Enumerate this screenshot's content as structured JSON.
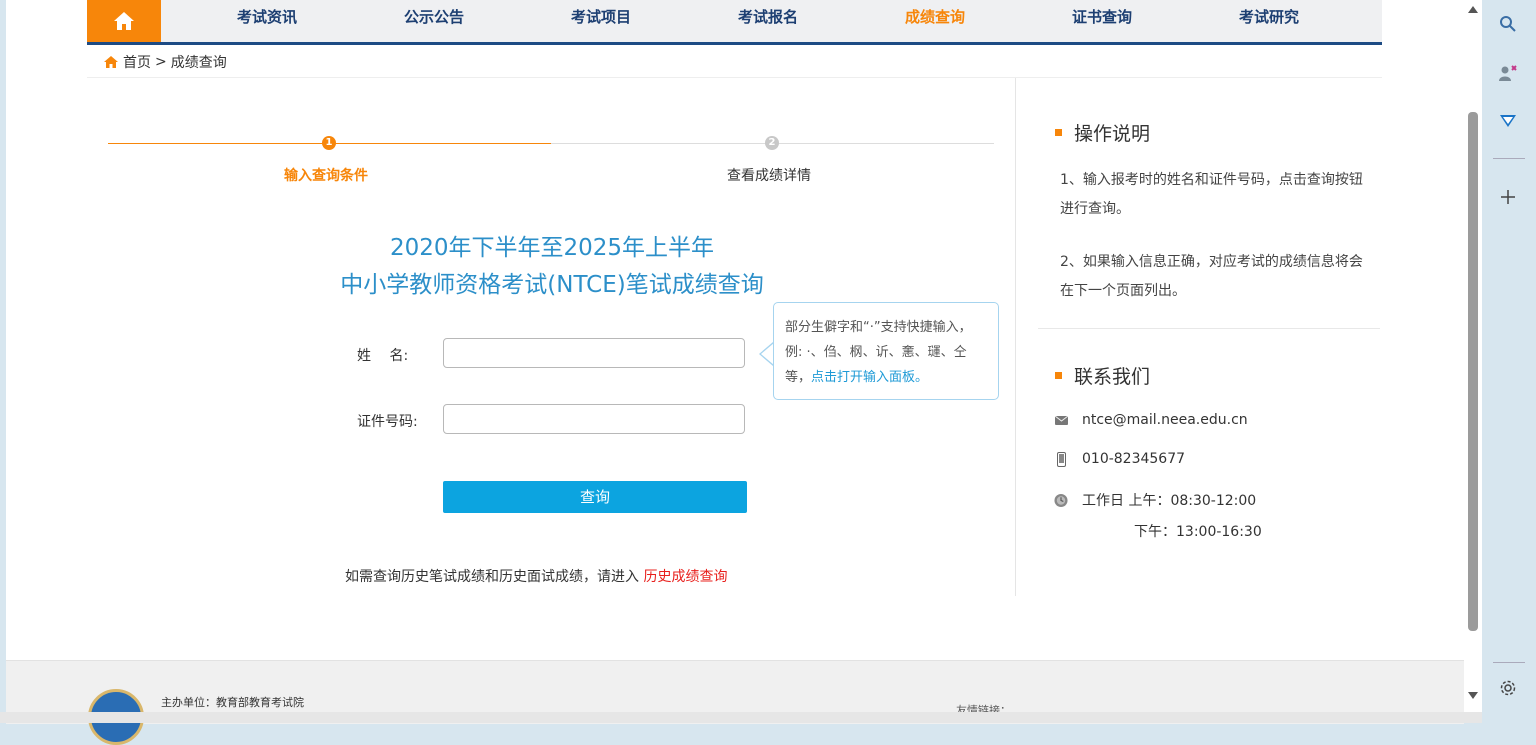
{
  "nav": {
    "items": [
      "考试资讯",
      "公示公告",
      "考试项目",
      "考试报名",
      "成绩查询",
      "证书查询",
      "考试研究"
    ],
    "active": "成绩查询"
  },
  "breadcrumb": {
    "home": "首页",
    "sep": ">",
    "current": "成绩查询"
  },
  "steps": [
    {
      "num": "1",
      "label": "输入查询条件",
      "active": true
    },
    {
      "num": "2",
      "label": "查看成绩详情",
      "active": false
    }
  ],
  "title": {
    "line1": "2020年下半年至2025年上半年",
    "line2": "中小学教师资格考试(NTCE)笔试成绩查询"
  },
  "form": {
    "name_label": "姓　 名:",
    "id_label": "证件号码:",
    "name_value": "",
    "id_value": "",
    "submit_label": "查询"
  },
  "tip": {
    "text": "部分生僻字和“·”支持快捷输入，例: ·、㑇、㭎、䜣、㥣、璭、仝等，",
    "link": "点击打开输入面板。"
  },
  "history": {
    "text": "如需查询历史笔试成绩和历史面试成绩，请进入",
    "link": "历史成绩查询"
  },
  "instructions": {
    "heading": "操作说明",
    "items": [
      "1、输入报考时的姓名和证件号码，点击查询按钮进行查询。",
      "2、如果输入信息正确，对应考试的成绩信息将会在下一个页面列出。"
    ]
  },
  "contact": {
    "heading": "联系我们",
    "email": "ntce@mail.neea.edu.cn",
    "phone": "010-82345677",
    "hours_am": "工作日 上午：08:30-12:00",
    "hours_pm": "下午：13:00-16:30"
  },
  "footer": {
    "host": "主办单位：教育部教育考试院",
    "links": "友情链接："
  },
  "colors": {
    "accent": "#f7860a",
    "nav_text": "#1d3f72",
    "link_blue": "#2c8fc9",
    "button": "#0ca4e0",
    "history_link": "#e8201d"
  }
}
